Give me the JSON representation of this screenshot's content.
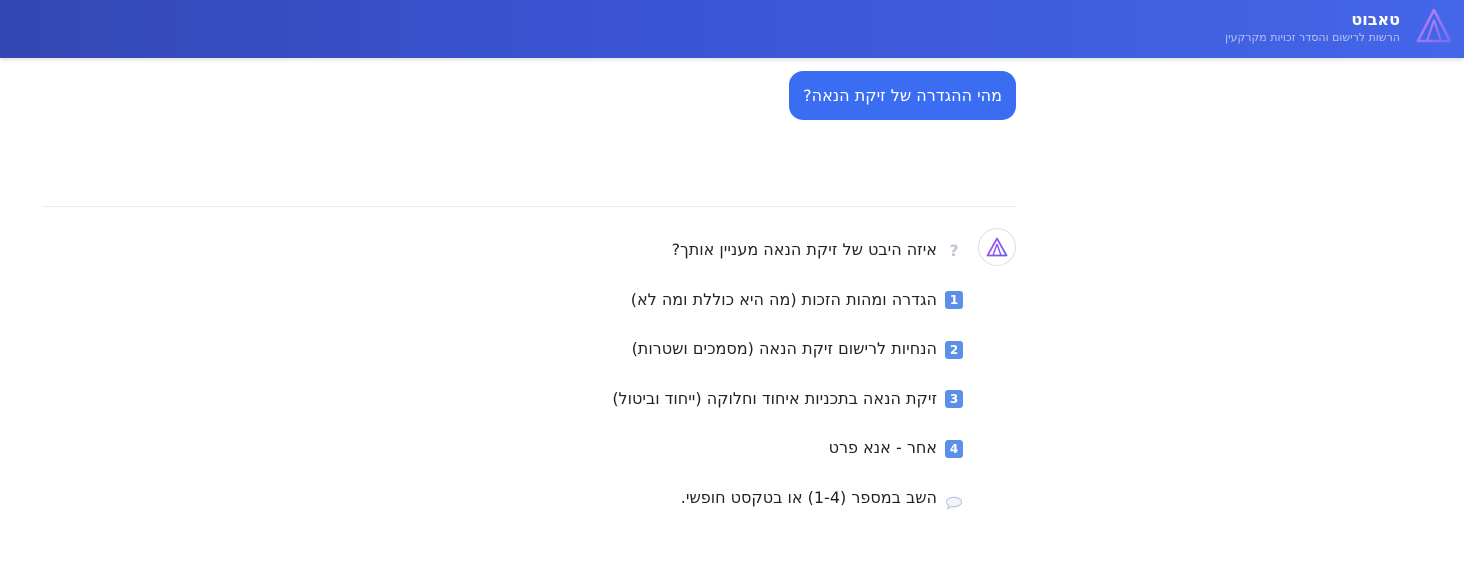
{
  "header": {
    "title": "טאבוט",
    "subtitle": "הרשות לרישום והסדר זכויות מקרקעין",
    "logo_icon": "triangle-logo-icon"
  },
  "chat": {
    "user_message": "מהי ההגדרה של זיקת הנאה?",
    "bot": {
      "avatar_icon": "triangle-logo-icon",
      "question_icon": "question-mark-icon",
      "question": "איזה היבט של זיקת הנאה מעניין אותך?",
      "options": [
        {
          "number": "1",
          "text": "הגדרה ומהות הזכות (מה היא כוללת ומה לא)"
        },
        {
          "number": "2",
          "text": "הנחיות לרישום זיקת הנאה (מסמכים ושטרות)"
        },
        {
          "number": "3",
          "text": "זיקת הנאה בתכניות איחוד וחלוקה (ייחוד וביטול)"
        },
        {
          "number": "4",
          "text": "אחר - אנא פרט"
        }
      ],
      "reply_hint_icon": "speech-bubble-icon",
      "reply_hint": "השב במספר (1-4) או בטקסט חופשי."
    }
  },
  "colors": {
    "header_start": "#3447b3",
    "header_end": "#4466e8",
    "user_bubble": "#3b6df2",
    "keycap": "#5b8fe8",
    "logo_purple": "#8b5cf6"
  }
}
